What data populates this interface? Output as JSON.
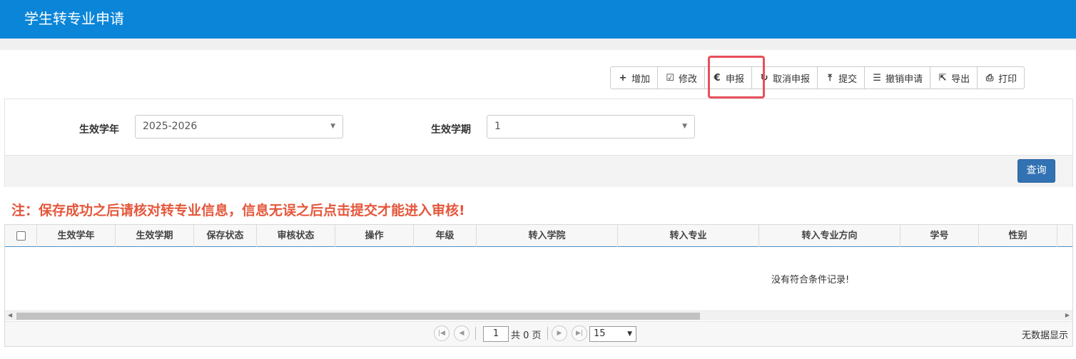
{
  "header": {
    "title": "学生转专业申请"
  },
  "toolbar": {
    "buttons": [
      {
        "label": "增加",
        "icon": "+"
      },
      {
        "label": "修改",
        "icon": "☑"
      },
      {
        "label": "申报",
        "icon": "€"
      },
      {
        "label": "取消申报",
        "icon": "↻"
      },
      {
        "label": "提交",
        "icon": "⤒"
      },
      {
        "label": "撤销申请",
        "icon": "☰"
      },
      {
        "label": "导出",
        "icon": "⇱"
      },
      {
        "label": "打印",
        "icon": "⎙"
      }
    ],
    "highlight_color": "#e8505b"
  },
  "filters": {
    "year_label": "生效学年",
    "year_value": "2025-2026",
    "term_label": "生效学期",
    "term_value": "1",
    "query_label": "查询"
  },
  "note": "注：保存成功之后请核对转专业信息，信息无误之后点击提交才能进入审核!",
  "table": {
    "columns": [
      "生效学年",
      "生效学期",
      "保存状态",
      "审核状态",
      "操作",
      "年级",
      "转入学院",
      "转入专业",
      "转入专业方向",
      "学号",
      "性别"
    ],
    "empty_message": "没有符合条件记录!"
  },
  "pager": {
    "page": "1",
    "total_text": "共 0 页",
    "page_size": "15",
    "info": "无数据显示"
  },
  "colors": {
    "header_bg": "#0a85d8",
    "query_btn": "#3172b3",
    "note": "#e4573b"
  }
}
